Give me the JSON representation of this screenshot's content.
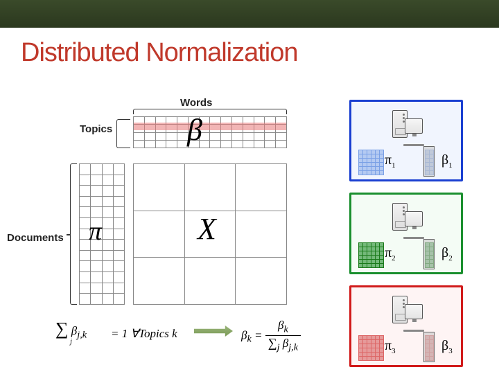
{
  "title": "Distributed Normalization",
  "labels": {
    "words": "Words",
    "topics": "Topics",
    "documents": "Documents"
  },
  "symbols": {
    "beta": "β",
    "pi": "π",
    "X": "X"
  },
  "formula": {
    "lhs_sum": "∑",
    "lhs_sub": "j",
    "lhs_body": "β",
    "lhs_idx": "j,k",
    "eq1": " = 1  ∀Topics k",
    "rhs_lhs": "β",
    "rhs_lhs_sub": "k",
    "rhs_eq": " = ",
    "frac_top": "β",
    "frac_top_sub": "k",
    "frac_bot_sum": "∑",
    "frac_bot_sub": "j",
    "frac_bot_body": "β",
    "frac_bot_idx": "j,k"
  },
  "nodes": [
    {
      "pi": "π",
      "pi_sub": "1",
      "beta": "β",
      "beta_sub": "1"
    },
    {
      "pi": "π",
      "pi_sub": "2",
      "beta": "β",
      "beta_sub": "2"
    },
    {
      "pi": "π",
      "pi_sub": "3",
      "beta": "β",
      "beta_sub": "3"
    }
  ],
  "grids": {
    "beta_top": {
      "rows": 4,
      "cols": 14
    },
    "pi_left": {
      "rows": 13,
      "cols": 4
    },
    "X": {
      "rows": 3,
      "cols": 3
    },
    "mini_pi": {
      "rows": 6,
      "cols": 6
    },
    "mini_beta": {
      "rows": 6,
      "cols": 2
    }
  }
}
